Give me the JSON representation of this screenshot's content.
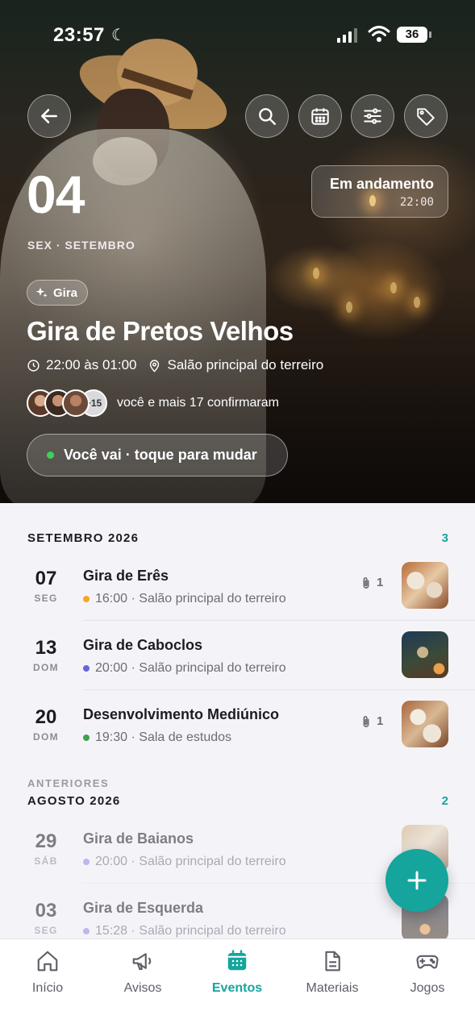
{
  "status_bar": {
    "time": "23:57",
    "battery": "36"
  },
  "hero": {
    "day": "04",
    "weekday_month": "SEX · SETEMBRO",
    "status": {
      "label": "Em andamento",
      "time": "22:00"
    },
    "chip": "Gira",
    "title": "Gira de Pretos Velhos",
    "time_range": "22:00 às 01:00",
    "location": "Salão principal do terreiro",
    "attendees_more": "+15",
    "attendees_text": "você e mais 17 confirmaram",
    "rsvp_label": "Você vai · toque para mudar"
  },
  "upcoming": {
    "header": "SETEMBRO 2026",
    "count": "3",
    "events": [
      {
        "day": "07",
        "weekday": "SEG",
        "title": "Gira de Erês",
        "time": "16:00",
        "location": "Salão principal do terreiro",
        "dot_color": "#f5a623",
        "attachments": "1"
      },
      {
        "day": "13",
        "weekday": "DOM",
        "title": "Gira de Caboclos",
        "time": "20:00",
        "location": "Salão principal do terreiro",
        "dot_color": "#6c63e0",
        "attachments": ""
      },
      {
        "day": "20",
        "weekday": "DOM",
        "title": "Desenvolvimento Mediúnico",
        "time": "19:30",
        "location": "Sala de estudos",
        "dot_color": "#3fa34d",
        "attachments": "1"
      }
    ]
  },
  "past": {
    "kicker": "ANTERIORES",
    "header": "AGOSTO 2026",
    "count": "2",
    "events": [
      {
        "day": "29",
        "weekday": "SÁB",
        "title": "Gira de Baianos",
        "time": "20:00",
        "location": "Salão principal do terreiro",
        "dot_color": "#8f86e8"
      },
      {
        "day": "03",
        "weekday": "SEG",
        "title": "Gira de Esquerda",
        "time": "15:28",
        "location": "Salão principal do terreiro",
        "dot_color": "#8f86e8"
      }
    ]
  },
  "tabs": [
    {
      "label": "Início",
      "icon": "home-icon"
    },
    {
      "label": "Avisos",
      "icon": "megaphone-icon"
    },
    {
      "label": "Eventos",
      "icon": "calendar-icon",
      "active": true
    },
    {
      "label": "Materiais",
      "icon": "document-icon"
    },
    {
      "label": "Jogos",
      "icon": "gamepad-icon"
    }
  ],
  "colors": {
    "accent": "#15a59d",
    "text": "#1b1b22",
    "muted": "#6c6c76"
  }
}
